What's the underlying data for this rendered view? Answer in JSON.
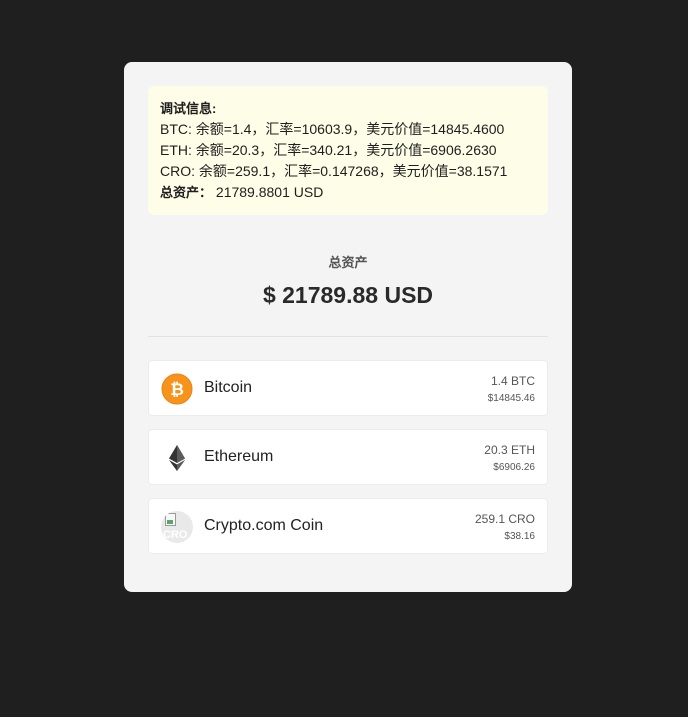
{
  "debug": {
    "title": "调试信息:",
    "lines": [
      "BTC: 余额=1.4，汇率=10603.9，美元价值=14845.4600",
      "ETH: 余额=20.3，汇率=340.21，美元价值=6906.2630",
      "CRO: 余额=259.1，汇率=0.147268，美元价值=38.1571"
    ],
    "total_label": "总资产：",
    "total_value": "21789.8801 USD"
  },
  "summary": {
    "label": "总资产",
    "value": "$ 21789.88 USD"
  },
  "assets": [
    {
      "name": "Bitcoin",
      "amount": "1.4 BTC",
      "usd": "$14845.46",
      "icon": "bitcoin-icon",
      "color": "#f7931a"
    },
    {
      "name": "Ethereum",
      "amount": "20.3 ETH",
      "usd": "$6906.26",
      "icon": "ethereum-icon",
      "color": "#343434"
    },
    {
      "name": "Crypto.com Coin",
      "amount": "259.1 CRO",
      "usd": "$38.16",
      "icon": "broken-image-icon",
      "alt": "CRO"
    }
  ],
  "colors": {
    "background": "#1f1f1f",
    "card": "#f4f4f4",
    "debug_bg": "#fefde7"
  }
}
